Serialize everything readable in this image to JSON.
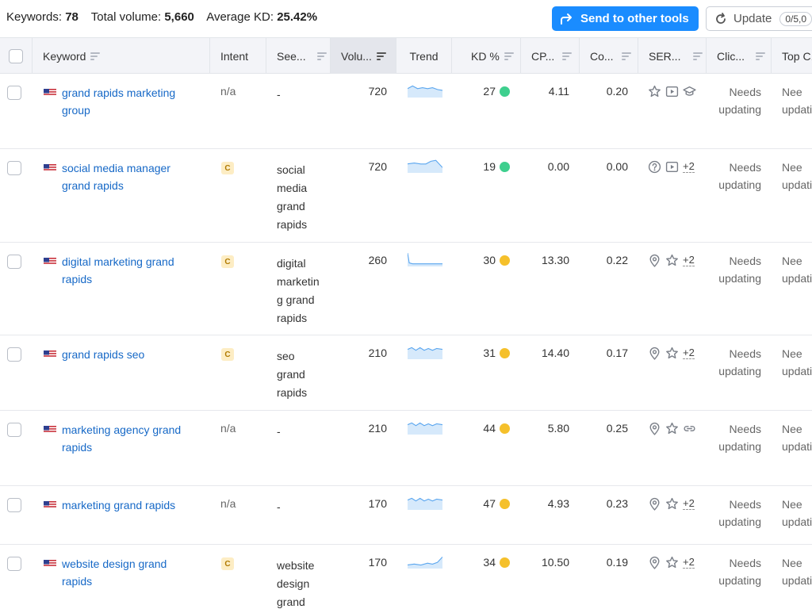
{
  "summary": {
    "keywords_label": "Keywords:",
    "keywords_value": "78",
    "volume_label": "Total volume:",
    "volume_value": "5,660",
    "kd_label": "Average KD:",
    "kd_value": "25.42%"
  },
  "toolbar": {
    "send_label": "Send to other tools",
    "update_label": "Update",
    "update_quota": "0/5,0"
  },
  "columns": {
    "keyword": "Keyword",
    "intent": "Intent",
    "seed": "See...",
    "volume": "Volu...",
    "trend": "Trend",
    "kd": "KD %",
    "cpc": "CP...",
    "com": "Co...",
    "serp": "SER...",
    "clicks": "Clic...",
    "topc": "Top C..."
  },
  "colors": {
    "accent": "#1a8cff",
    "link": "#1769c7",
    "kd_green": "#3ecf8e",
    "kd_yellow": "#f5c02b"
  },
  "rows": [
    {
      "keyword": [
        "grand rapids marketing",
        "group"
      ],
      "intent": "n/a",
      "seed": [
        "-"
      ],
      "volume": "720",
      "trend": "flat-high",
      "kd": "27",
      "kd_color": "green",
      "cpc": "4.11",
      "com": "0.20",
      "serp_icons": [
        "star-icon",
        "video-icon",
        "academic-cap-icon"
      ],
      "serp_more": "",
      "clicks": [
        "Needs",
        "updating"
      ],
      "topc": [
        "Nee",
        "updati"
      ]
    },
    {
      "keyword": [
        "social media manager",
        "grand rapids"
      ],
      "intent": "C",
      "seed": [
        "social",
        "media",
        "grand",
        "rapids"
      ],
      "volume": "720",
      "trend": "bump",
      "kd": "19",
      "kd_color": "green",
      "cpc": "0.00",
      "com": "0.00",
      "serp_icons": [
        "question-icon",
        "video-icon"
      ],
      "serp_more": "+2",
      "clicks": [
        "Needs",
        "updating"
      ],
      "topc": [
        "Nee",
        "updati"
      ]
    },
    {
      "keyword": [
        "digital marketing grand",
        "rapids"
      ],
      "intent": "C",
      "seed": [
        "digital",
        "marketin",
        "g grand",
        "rapids"
      ],
      "volume": "260",
      "trend": "drop",
      "kd": "30",
      "kd_color": "yellow",
      "cpc": "13.30",
      "com": "0.22",
      "serp_icons": [
        "pin-icon",
        "star-icon"
      ],
      "serp_more": "+2",
      "clicks": [
        "Needs",
        "updating"
      ],
      "topc": [
        "Nee",
        "updati"
      ]
    },
    {
      "keyword": [
        "grand rapids seo"
      ],
      "intent": "C",
      "seed": [
        "seo",
        "grand",
        "rapids"
      ],
      "volume": "210",
      "trend": "wavy",
      "kd": "31",
      "kd_color": "yellow",
      "cpc": "14.40",
      "com": "0.17",
      "serp_icons": [
        "pin-icon",
        "star-icon"
      ],
      "serp_more": "+2",
      "clicks": [
        "Needs",
        "updating"
      ],
      "topc": [
        "Nee",
        "updati"
      ]
    },
    {
      "keyword": [
        "marketing agency grand",
        "rapids"
      ],
      "intent": "n/a",
      "seed": [
        "-"
      ],
      "volume": "210",
      "trend": "wavy",
      "kd": "44",
      "kd_color": "yellow",
      "cpc": "5.80",
      "com": "0.25",
      "serp_icons": [
        "pin-icon",
        "star-icon",
        "link-icon"
      ],
      "serp_more": "",
      "clicks": [
        "Needs",
        "updating"
      ],
      "topc": [
        "Nee",
        "updati"
      ]
    },
    {
      "keyword": [
        "marketing grand rapids"
      ],
      "intent": "n/a",
      "seed": [
        "-"
      ],
      "volume": "170",
      "trend": "wavy",
      "kd": "47",
      "kd_color": "yellow",
      "cpc": "4.93",
      "com": "0.23",
      "serp_icons": [
        "pin-icon",
        "star-icon"
      ],
      "serp_more": "+2",
      "clicks": [
        "Needs",
        "updating"
      ],
      "topc": [
        "Nee",
        "updati"
      ]
    },
    {
      "keyword": [
        "website design grand",
        "rapids"
      ],
      "intent": "C",
      "seed": [
        "website",
        "design",
        "grand"
      ],
      "volume": "170",
      "trend": "rise",
      "kd": "34",
      "kd_color": "yellow",
      "cpc": "10.50",
      "com": "0.19",
      "serp_icons": [
        "pin-icon",
        "star-icon"
      ],
      "serp_more": "+2",
      "clicks": [
        "Needs",
        "updating"
      ],
      "topc": [
        "Nee",
        "updati"
      ]
    }
  ]
}
